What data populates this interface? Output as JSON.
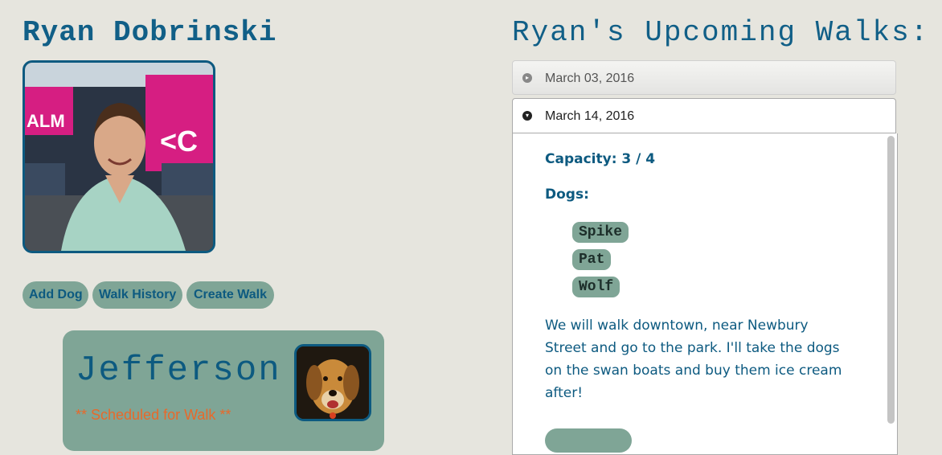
{
  "profile": {
    "name": "Ryan Dobrinski",
    "buttons": {
      "add_dog": "Add Dog",
      "walk_history": "Walk History",
      "create_walk": "Create Walk"
    }
  },
  "dog_card": {
    "name": "Jefferson",
    "status": "** Scheduled for Walk **"
  },
  "walks": {
    "title": "Ryan's Upcoming Walks:",
    "items": [
      {
        "date": "March 03, 2016",
        "expanded": false
      },
      {
        "date": "March 14, 2016",
        "expanded": true
      }
    ],
    "detail": {
      "capacity": "Capacity: 3 / 4",
      "dogs_heading": "Dogs:",
      "dogs": [
        "Spike",
        "Pat",
        "Wolf"
      ],
      "description": "We will walk downtown, near Newbury Street and go to the park. I'll take the dogs on the swan boats and buy them ice cream after!"
    }
  },
  "colors": {
    "background": "#e6e5de",
    "primary_text": "#0d5a80",
    "button_bg": "#7fa596",
    "status_orange": "#e8692a"
  },
  "icons": {
    "collapsed": "arrow-right-circle-icon",
    "expanded": "arrow-down-circle-icon"
  }
}
